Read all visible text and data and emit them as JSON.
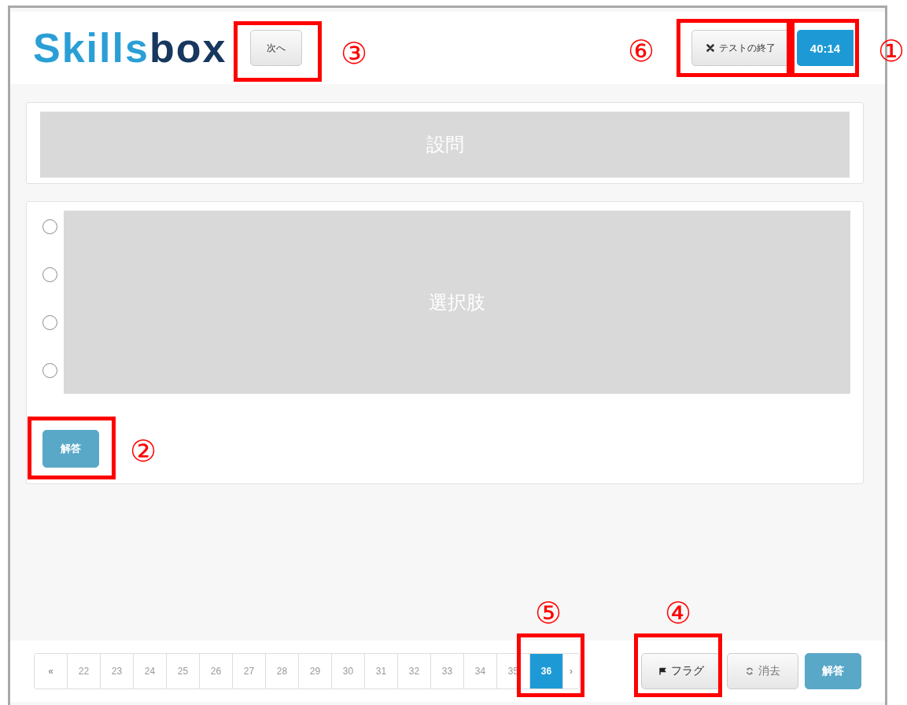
{
  "logo": {
    "light": "Skills",
    "dark": "box"
  },
  "header": {
    "next_button": "次へ",
    "end_button": "テストの終了",
    "timer": "40:14"
  },
  "question": {
    "placeholder": "設問"
  },
  "choices": [
    {
      "selected": false
    },
    {
      "selected": false
    },
    {
      "selected": false
    },
    {
      "selected": false
    }
  ],
  "choices_placeholder": "選択肢",
  "answer_button": "解答",
  "pagination": [
    {
      "label": "«",
      "kind": "nav",
      "selected": false
    },
    {
      "label": "22",
      "kind": "page",
      "selected": false
    },
    {
      "label": "23",
      "kind": "page",
      "selected": false
    },
    {
      "label": "24",
      "kind": "page",
      "selected": false
    },
    {
      "label": "25",
      "kind": "page",
      "selected": false
    },
    {
      "label": "26",
      "kind": "page",
      "selected": false
    },
    {
      "label": "27",
      "kind": "page",
      "selected": false
    },
    {
      "label": "28",
      "kind": "page",
      "selected": false
    },
    {
      "label": "29",
      "kind": "page",
      "selected": false
    },
    {
      "label": "30",
      "kind": "page",
      "selected": false
    },
    {
      "label": "31",
      "kind": "page",
      "selected": false
    },
    {
      "label": "32",
      "kind": "page",
      "selected": false
    },
    {
      "label": "33",
      "kind": "page",
      "selected": false
    },
    {
      "label": "34",
      "kind": "page",
      "selected": false
    },
    {
      "label": "35",
      "kind": "page",
      "selected": false
    },
    {
      "label": "36",
      "kind": "page",
      "selected": true
    },
    {
      "label": "›",
      "kind": "nav",
      "selected": false
    }
  ],
  "footer_buttons": [
    {
      "label": "フラグ",
      "kind": "flag"
    },
    {
      "label": "消去",
      "kind": "clear"
    },
    {
      "label": "解答",
      "kind": "answer"
    }
  ],
  "annotations": [
    {
      "label": "①",
      "kind": "timer"
    },
    {
      "label": "②",
      "kind": "answer"
    },
    {
      "label": "③",
      "kind": "next"
    },
    {
      "label": "④",
      "kind": "flag"
    },
    {
      "label": "⑤",
      "kind": "page"
    },
    {
      "label": "⑥",
      "kind": "end"
    }
  ]
}
